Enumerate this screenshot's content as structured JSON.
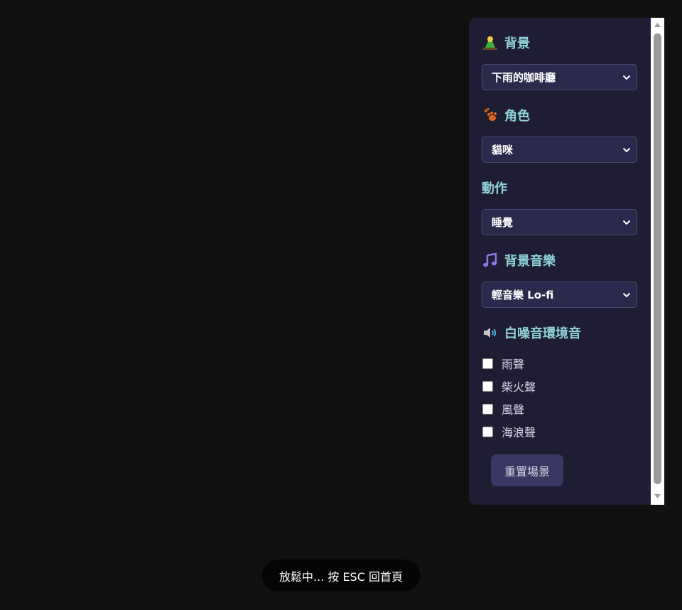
{
  "panel": {
    "background": {
      "title": "背景",
      "icon": "park-icon",
      "selected": "下雨的咖啡廳"
    },
    "character": {
      "title": "角色",
      "icon": "paw-icon",
      "selected": "貓咪"
    },
    "action": {
      "title": "動作",
      "selected": "睡覺"
    },
    "music": {
      "title": "背景音樂",
      "icon": "music-note-icon",
      "selected": "輕音樂 Lo-fi"
    },
    "noise": {
      "title": "白噪音環境音",
      "icon": "speaker-icon",
      "options": [
        {
          "label": "雨聲",
          "checked": false
        },
        {
          "label": "柴火聲",
          "checked": false
        },
        {
          "label": "風聲",
          "checked": false
        },
        {
          "label": "海浪聲",
          "checked": false
        }
      ]
    },
    "reset_label": "重置場景"
  },
  "toast": "放鬆中... 按 ESC 回首頁",
  "colors": {
    "page_bg": "#111111",
    "panel_bg": "#1f1d33",
    "title": "#8fd3d8",
    "select_bg": "#2b2a4d"
  }
}
